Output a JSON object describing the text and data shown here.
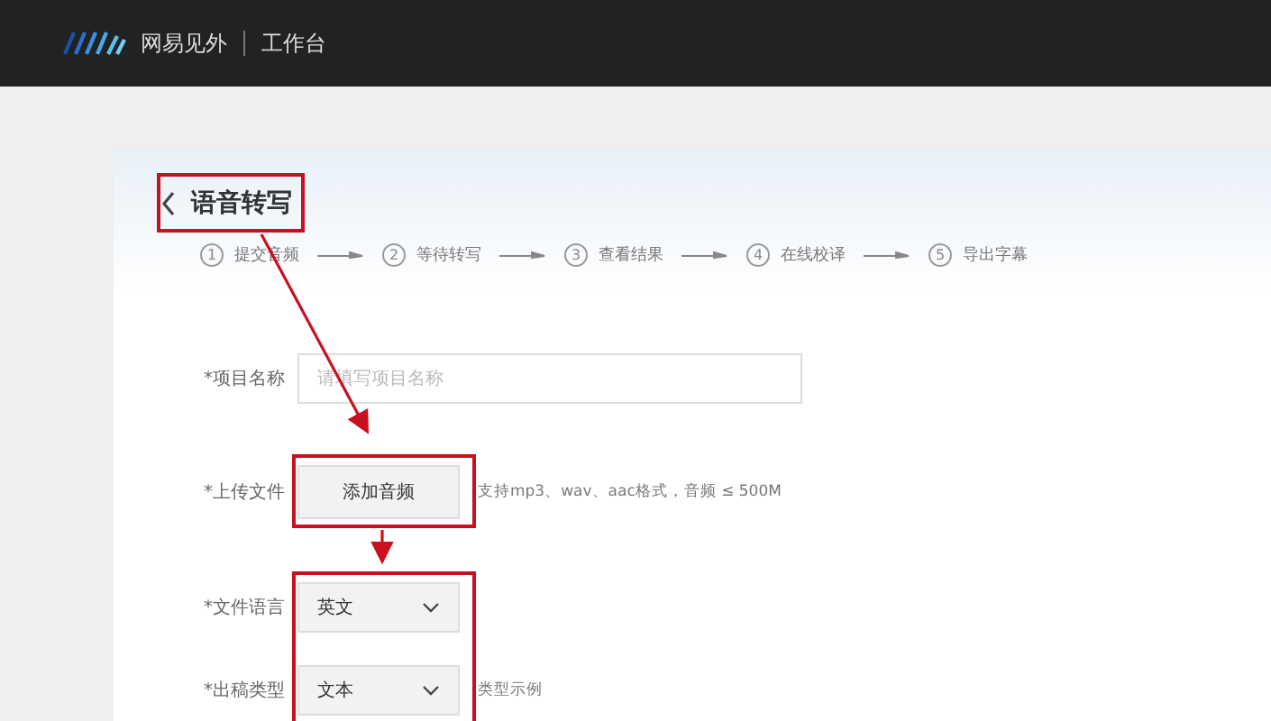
{
  "header": {
    "brand": "网易见外",
    "workspace": "工作台"
  },
  "page": {
    "title": "语音转写"
  },
  "steps": [
    {
      "number": "1",
      "label": "提交音频"
    },
    {
      "number": "2",
      "label": "等待转写"
    },
    {
      "number": "3",
      "label": "查看结果"
    },
    {
      "number": "4",
      "label": "在线校译"
    },
    {
      "number": "5",
      "label": "导出字幕"
    }
  ],
  "form": [
    {
      "kind": "text",
      "label": "*项目名称",
      "placeholder": "请填写项目名称"
    },
    {
      "kind": "upload",
      "label": "*上传文件",
      "button": "添加音频",
      "hint": "支持mp3、wav、aac格式，音频 ≤ 500M"
    },
    {
      "kind": "select",
      "label": "*文件语言",
      "value": "英文"
    },
    {
      "kind": "select",
      "label": "*出稿类型",
      "value": "文本",
      "hint": "类型示例"
    }
  ]
}
